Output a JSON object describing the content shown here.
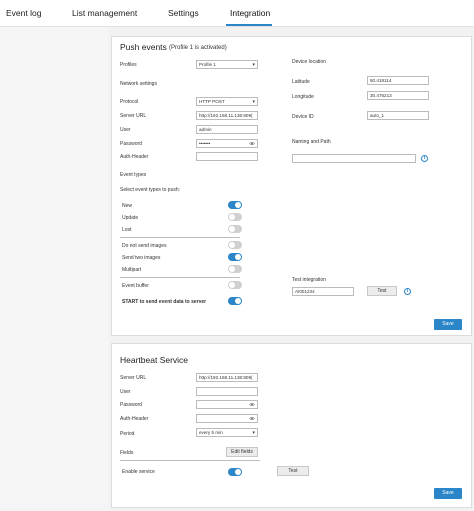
{
  "tabs": [
    "Event log",
    "List management",
    "Settings",
    "Integration"
  ],
  "push": {
    "title": "Push events",
    "subtitle": "(Profile 1 is activated)",
    "profiles_label": "Profiles",
    "profile_value": "Profile 1",
    "network_settings": "Network settings",
    "protocol_label": "Protocol",
    "protocol_value": "HTTP POST",
    "server_url_label": "Server URL",
    "server_url_value": "http://192.168.11.136:809(",
    "user_label": "User",
    "user_value": "admin",
    "password_label": "Password",
    "password_value": "•••••••",
    "auth_label": "Auth-Header",
    "event_types": "Event types",
    "select_event_types": "Select event types to push:",
    "events": [
      {
        "label": "New",
        "on": true
      },
      {
        "label": "Update",
        "on": false
      },
      {
        "label": "Lost",
        "on": false
      }
    ],
    "images": [
      {
        "label": "Do not send images",
        "on": false
      },
      {
        "label": "Send two images",
        "on": true
      },
      {
        "label": "Multipart",
        "on": false
      }
    ],
    "event_buffer_label": "Event buffer",
    "event_buffer_on": false,
    "start_label": "START to send event data to server",
    "start_on": true,
    "device_location": "Device location",
    "latitude_label": "Latitude",
    "latitude_value": "50.418114",
    "longitude_label": "Longitude",
    "longitude_value": "30.476213",
    "device_id_label": "Device ID",
    "device_id_value": "auto_1",
    "naming_label": "Naming and Path",
    "test_integration": "Test integration",
    "test_value": "AI001234",
    "test_button": "Test",
    "save_button": "Save"
  },
  "heartbeat": {
    "title": "Heartbeat Service",
    "server_url_label": "Server URL",
    "server_url_value": "http://192.168.11.136:809(",
    "user_label": "User",
    "password_label": "Password",
    "auth_label": "Auth-Header",
    "period_label": "Period",
    "period_value": "every 5 min",
    "fields_label": "Fields",
    "edit_fields": "Edit fields",
    "enable_label": "Enable service",
    "enable_on": true,
    "test_button": "Test",
    "save_button": "Save"
  },
  "colors": {
    "accent": "#2a86c9",
    "toggle_off": "#d0d0d0"
  }
}
